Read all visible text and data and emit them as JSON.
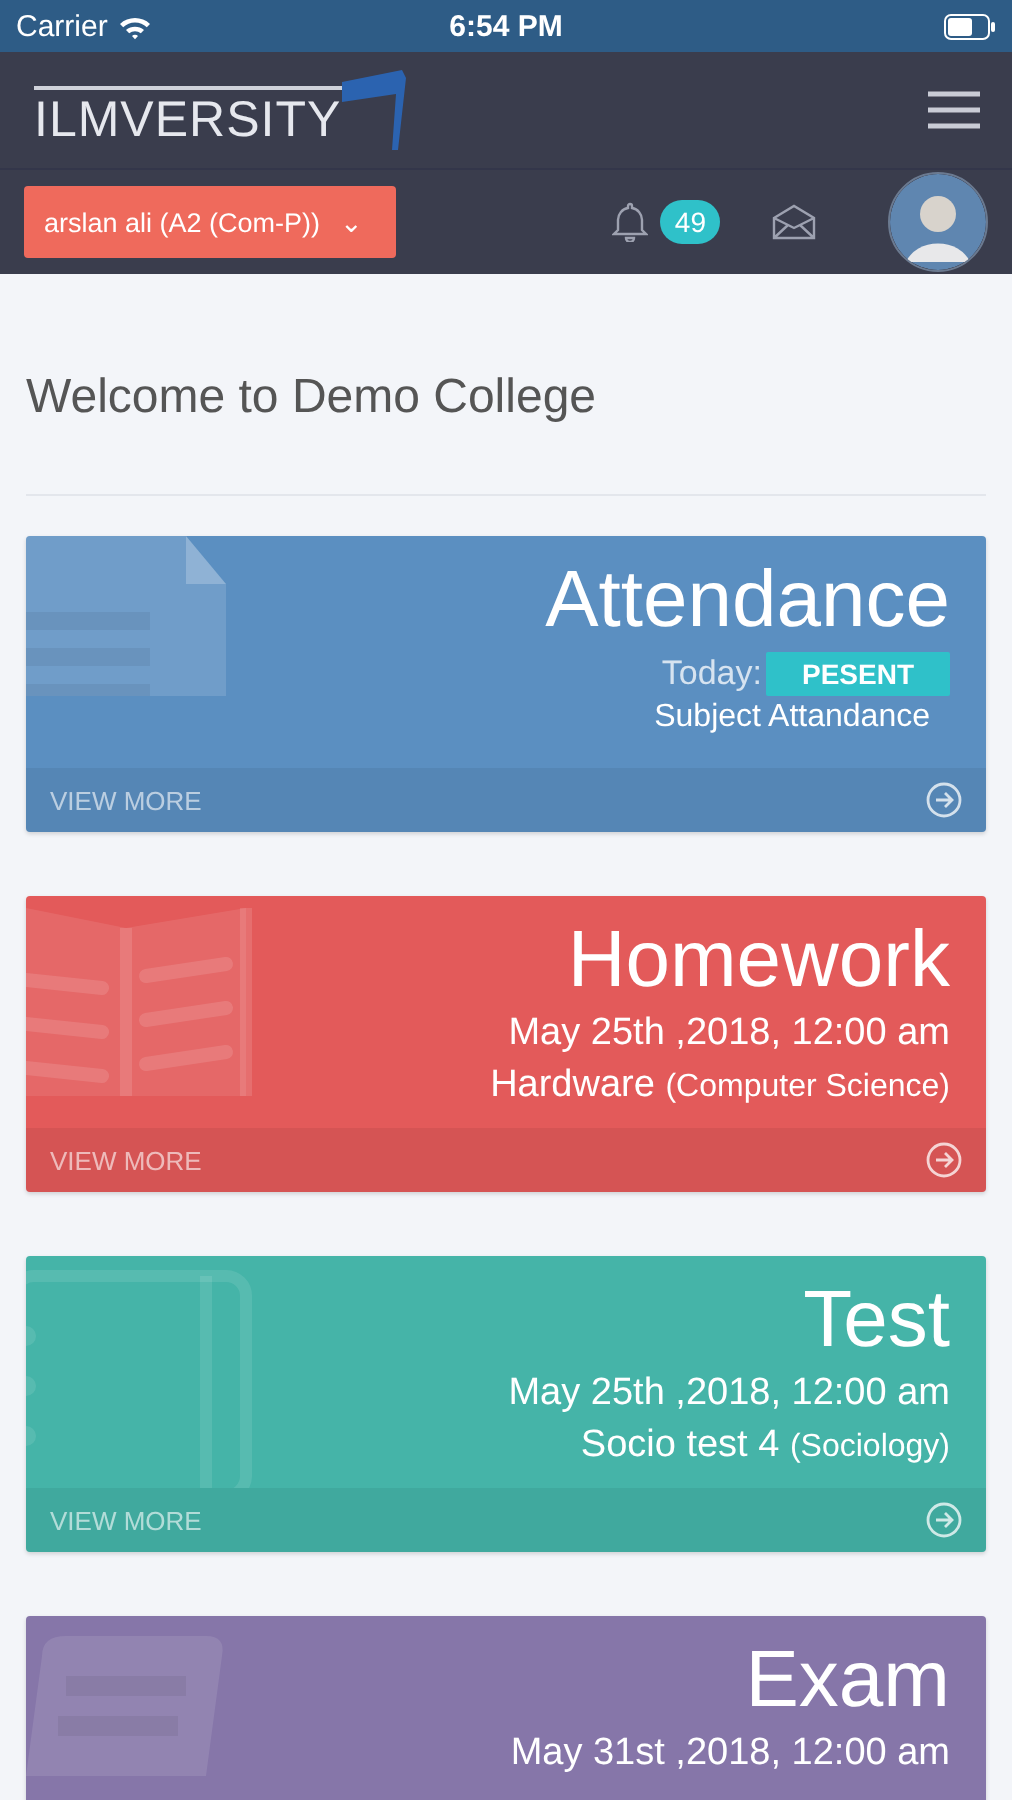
{
  "status_bar": {
    "carrier": "Carrier",
    "time": "6:54 PM"
  },
  "header": {
    "logo": "ILMVERSITY",
    "user_selector": "arslan ali (A2 (Com-P))",
    "caret": "⌄",
    "notification_count": "49"
  },
  "welcome": "Welcome to Demo College",
  "cards": [
    {
      "kind": "attendance",
      "title": "Attendance",
      "status_label": "Today:",
      "status": "PESENT",
      "subtitle": "Subject Attandance",
      "action": "VIEW MORE",
      "color": "#5b8fc1"
    },
    {
      "kind": "homework",
      "title": "Homework",
      "date": "May 25th ,2018, 12:00 am",
      "subject": "Hardware",
      "course": "(Computer Science)",
      "action": "VIEW MORE",
      "color": "#e35a5a"
    },
    {
      "kind": "test",
      "title": "Test",
      "date": "May 25th ,2018, 12:00 am",
      "subject": "Socio test 4",
      "course": "(Sociology)",
      "action": "VIEW MORE",
      "color": "#45b4a8"
    },
    {
      "kind": "exam",
      "title": "Exam",
      "date": "May 31st ,2018, 12:00 am",
      "color": "#8676a9"
    }
  ]
}
